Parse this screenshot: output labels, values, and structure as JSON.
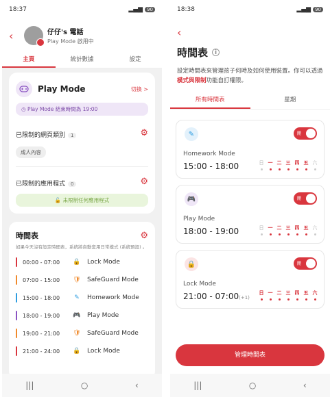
{
  "left": {
    "status": {
      "time": "18:37",
      "battery": "90"
    },
    "header": {
      "name": "仔仔's 電話",
      "subtitle": "Play Mode 啟用中"
    },
    "tabs": [
      {
        "label": "主頁"
      },
      {
        "label": "統計數據"
      },
      {
        "label": "設定"
      }
    ],
    "mode_card": {
      "title": "Play Mode",
      "switch": "切換 >",
      "pill": "Play Mode 結束時間為 19:00",
      "web_label": "已限制的網頁類別",
      "web_count": "1",
      "web_chip": "成人內容",
      "app_label": "已限制的應用程式",
      "app_count": "0",
      "app_none": "未限制任何應用程式"
    },
    "schedule": {
      "title": "時間表",
      "desc": "如果今天沒有設定時間表，系統將自動套用日常模式 (系統預設) 。",
      "items": [
        {
          "time": "00:00 - 07:00",
          "name": "Lock Mode",
          "color": "#d9363e",
          "icon": "lock-icon",
          "glyph": "🔒"
        },
        {
          "time": "07:00 - 15:00",
          "name": "SafeGuard Mode",
          "color": "#f08a2c",
          "icon": "shield-icon",
          "glyph": "🛡"
        },
        {
          "time": "15:00 - 18:00",
          "name": "Homework Mode",
          "color": "#2e9de0",
          "icon": "pencil-icon",
          "glyph": "✎"
        },
        {
          "time": "18:00 - 19:00",
          "name": "Play Mode",
          "color": "#8a53c2",
          "icon": "gamepad-icon",
          "glyph": "🎮"
        },
        {
          "time": "19:00 - 21:00",
          "name": "SafeGuard Mode",
          "color": "#f08a2c",
          "icon": "shield-icon",
          "glyph": "🛡"
        },
        {
          "time": "21:00 - 24:00",
          "name": "Lock Mode",
          "color": "#d9363e",
          "icon": "lock-icon",
          "glyph": "🔒"
        }
      ]
    }
  },
  "right": {
    "status": {
      "time": "18:38",
      "battery": "90"
    },
    "title": "時間表",
    "desc_before": "設定時間表來管理孩子何時及如何使用裝置。你可以透過",
    "desc_link": "模式與限制",
    "desc_after": "功能自訂權限。",
    "tabs": [
      {
        "label": "所有時間表"
      },
      {
        "label": "星期"
      }
    ],
    "toggle_label": "開",
    "day_labels": [
      "日",
      "一",
      "二",
      "三",
      "四",
      "五",
      "六"
    ],
    "modes": [
      {
        "name": "Homework Mode",
        "time": "15:00 - 18:00",
        "plus": "",
        "icon": "pencil-icon",
        "glyph": "✎",
        "bg": "#e3f1fb",
        "fg": "#2e9de0",
        "days": [
          false,
          true,
          true,
          true,
          true,
          true,
          false
        ]
      },
      {
        "name": "Play Mode",
        "time": "18:00 - 19:00",
        "plus": "",
        "icon": "gamepad-icon",
        "glyph": "🎮",
        "bg": "#efe6f7",
        "fg": "#8a53c2",
        "days": [
          false,
          true,
          true,
          true,
          true,
          true,
          false
        ]
      },
      {
        "name": "Lock Mode",
        "time": "21:00 - 07:00",
        "plus": "(+1)",
        "icon": "lock-icon",
        "glyph": "🔒",
        "bg": "#fbe4e4",
        "fg": "#d9363e",
        "days": [
          true,
          true,
          true,
          true,
          true,
          true,
          true
        ]
      }
    ],
    "manage_button": "管理時間表"
  }
}
